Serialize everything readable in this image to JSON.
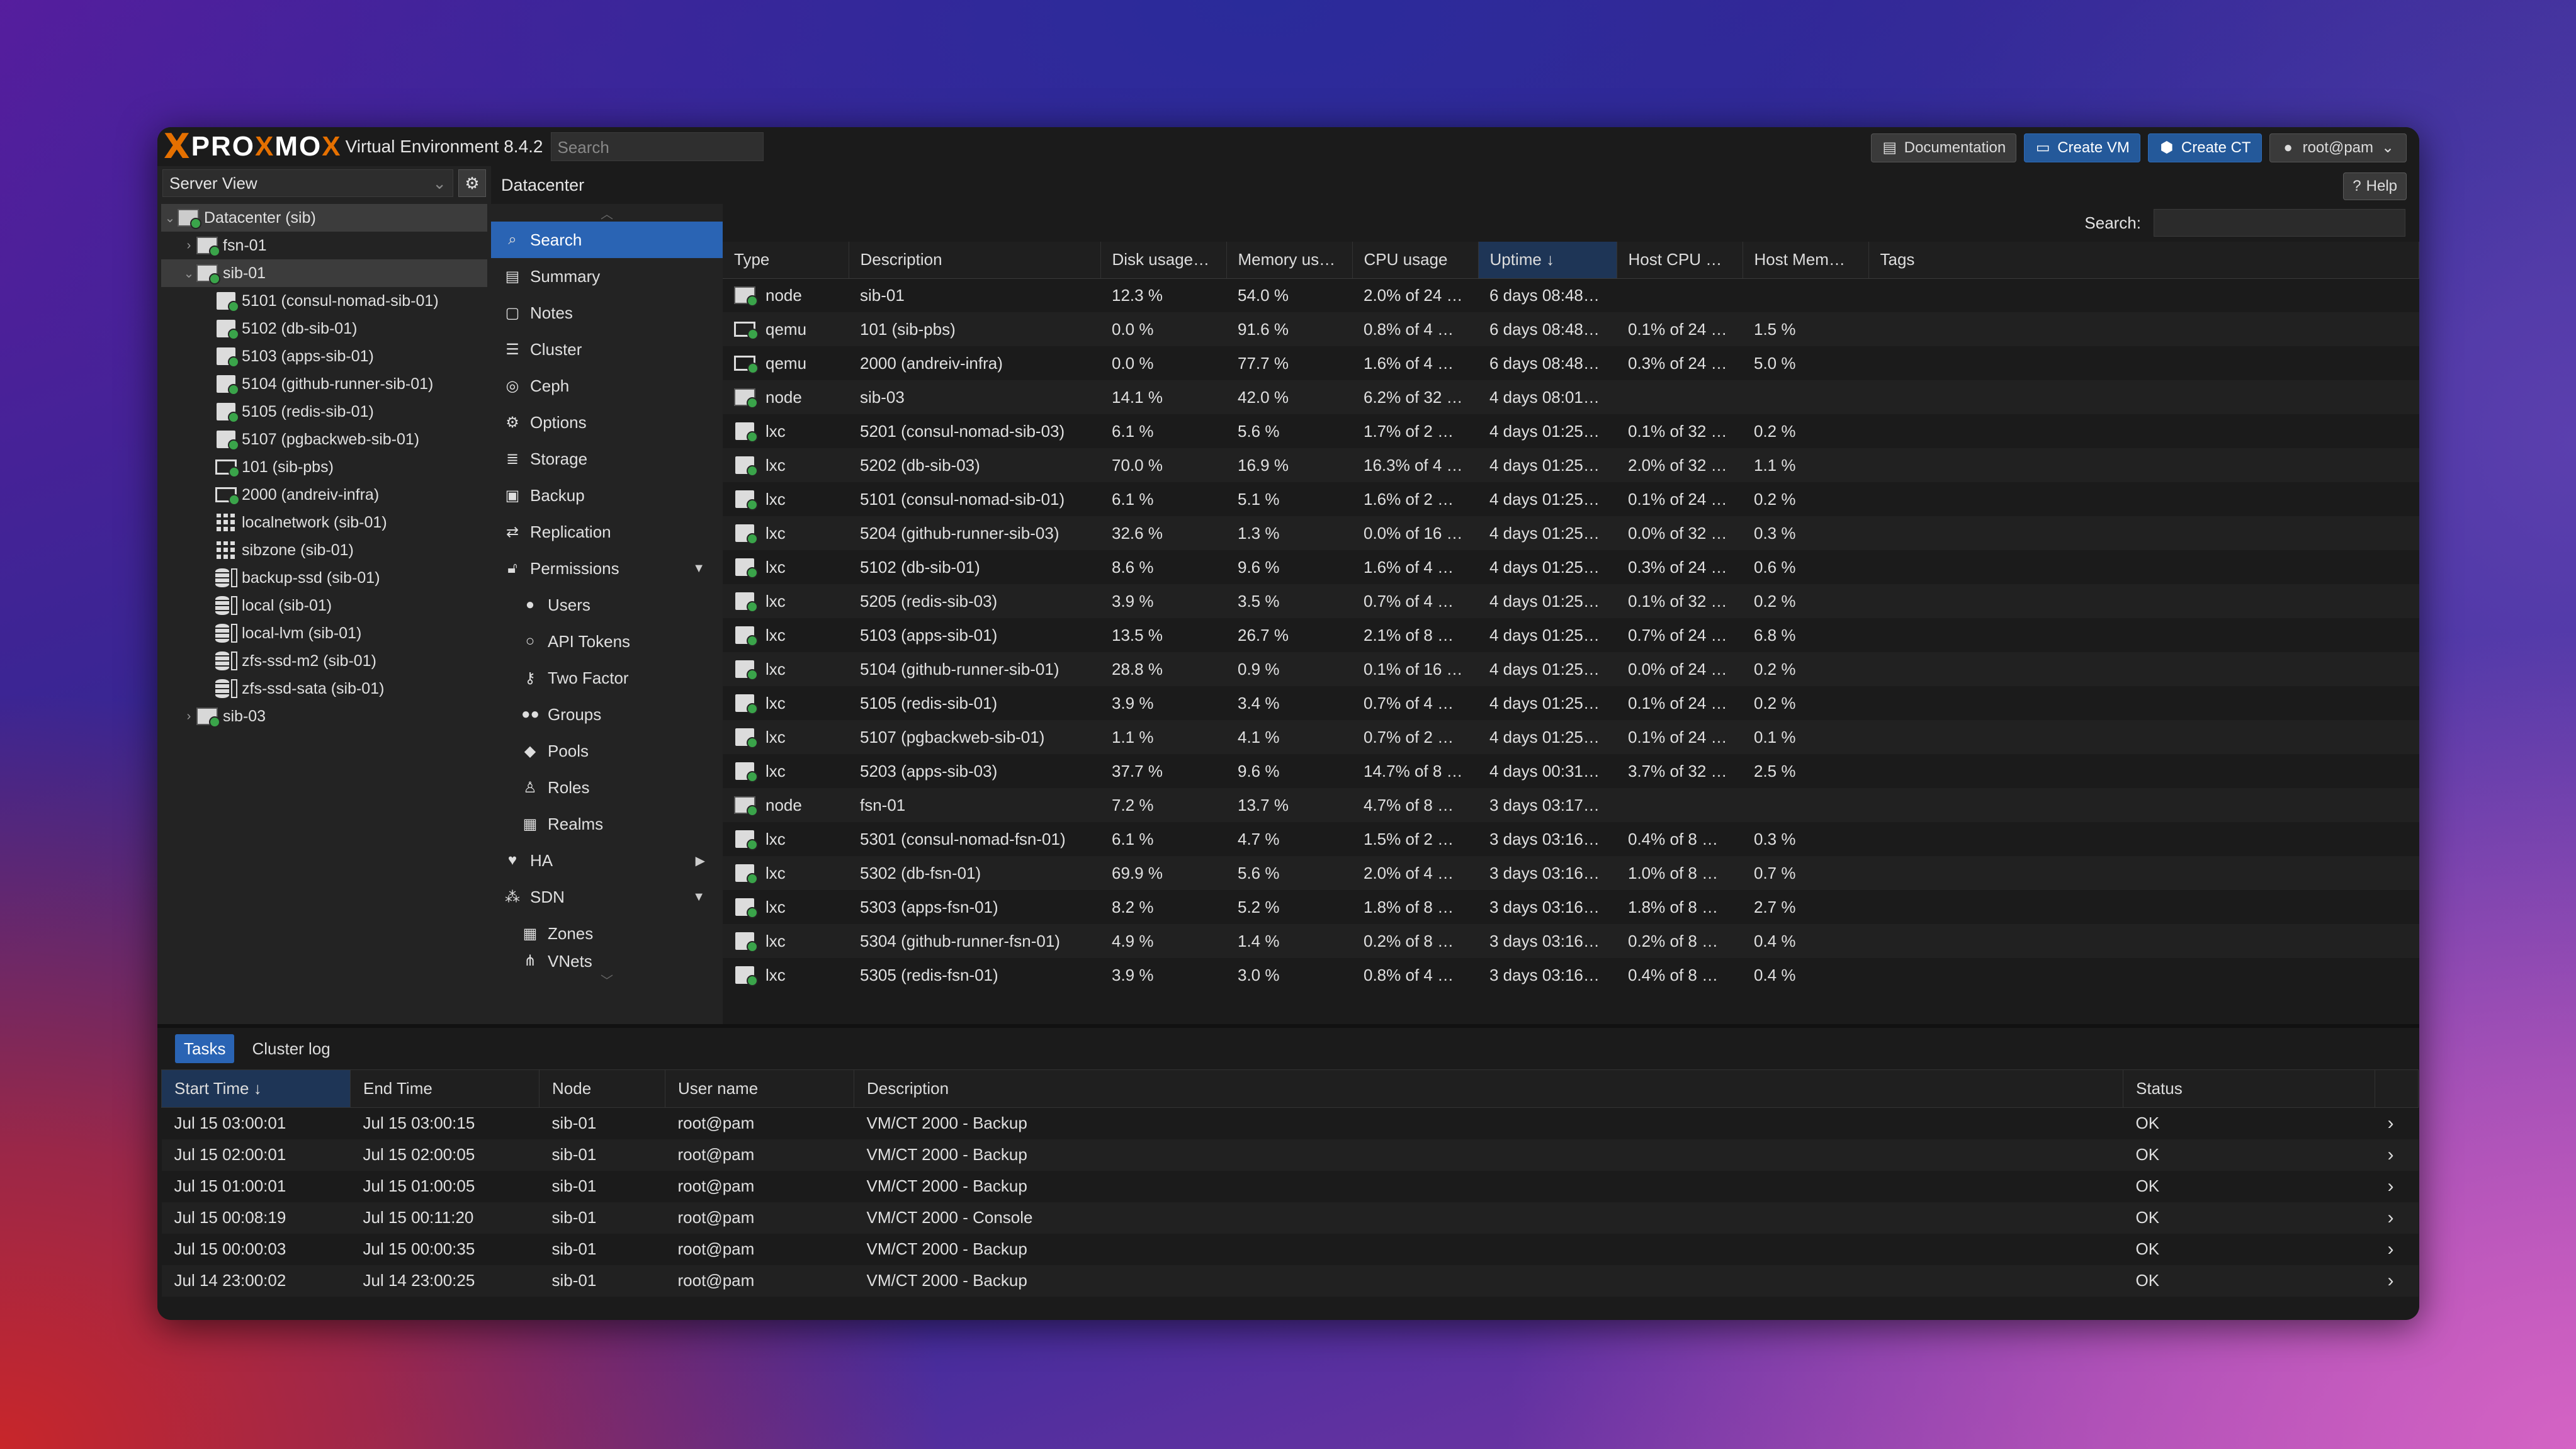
{
  "app": {
    "logo_text_pro": "PRO",
    "logo_x": "X",
    "logo_text_mox": "MO",
    "logo_text_x2": "X",
    "subtitle": "Virtual Environment 8.4.2",
    "search_placeholder": "Search"
  },
  "toolbar": {
    "documentation": "Documentation",
    "create_vm": "Create VM",
    "create_ct": "Create CT",
    "user": "root@pam"
  },
  "resource_tree": {
    "view": "Server View",
    "items": [
      {
        "label": "Datacenter (sib)",
        "icon": "datacenter-icon"
      },
      {
        "label": "fsn-01",
        "icon": "node-icon"
      },
      {
        "label": "sib-01",
        "icon": "node-icon"
      },
      {
        "label": "5101 (consul-nomad-sib-01)",
        "icon": "container-icon"
      },
      {
        "label": "5102 (db-sib-01)",
        "icon": "container-icon"
      },
      {
        "label": "5103 (apps-sib-01)",
        "icon": "container-icon"
      },
      {
        "label": "5104 (github-runner-sib-01)",
        "icon": "container-icon"
      },
      {
        "label": "5105 (redis-sib-01)",
        "icon": "container-icon"
      },
      {
        "label": "5107 (pgbackweb-sib-01)",
        "icon": "container-icon"
      },
      {
        "label": "101 (sib-pbs)",
        "icon": "vm-icon"
      },
      {
        "label": "2000 (andreiv-infra)",
        "icon": "vm-icon"
      },
      {
        "label": "localnetwork (sib-01)",
        "icon": "network-grid-icon"
      },
      {
        "label": "sibzone (sib-01)",
        "icon": "network-grid-icon"
      },
      {
        "label": "backup-ssd (sib-01)",
        "icon": "storage-icon"
      },
      {
        "label": "local (sib-01)",
        "icon": "storage-icon"
      },
      {
        "label": "local-lvm (sib-01)",
        "icon": "storage-icon"
      },
      {
        "label": "zfs-ssd-m2 (sib-01)",
        "icon": "storage-icon"
      },
      {
        "label": "zfs-ssd-sata (sib-01)",
        "icon": "storage-icon"
      },
      {
        "label": "sib-03",
        "icon": "node-icon"
      }
    ]
  },
  "breadcrumb": "Datacenter",
  "help": "Help",
  "menu": [
    {
      "label": "Search",
      "icon": "search-icon"
    },
    {
      "label": "Summary",
      "icon": "book-icon"
    },
    {
      "label": "Notes",
      "icon": "notes-icon"
    },
    {
      "label": "Cluster",
      "icon": "server-icon"
    },
    {
      "label": "Ceph",
      "icon": "ceph-icon"
    },
    {
      "label": "Options",
      "icon": "gear-icon"
    },
    {
      "label": "Storage",
      "icon": "database-icon"
    },
    {
      "label": "Backup",
      "icon": "floppy-icon"
    },
    {
      "label": "Replication",
      "icon": "retweet-icon"
    },
    {
      "label": "Permissions",
      "icon": "unlock-icon"
    },
    {
      "label": "Users",
      "icon": "user-icon"
    },
    {
      "label": "API Tokens",
      "icon": "user-outline-icon"
    },
    {
      "label": "Two Factor",
      "icon": "key-icon"
    },
    {
      "label": "Groups",
      "icon": "users-icon"
    },
    {
      "label": "Pools",
      "icon": "tags-icon"
    },
    {
      "label": "Roles",
      "icon": "male-icon"
    },
    {
      "label": "Realms",
      "icon": "address-book-icon"
    },
    {
      "label": "HA",
      "icon": "heartbeat-icon"
    },
    {
      "label": "SDN",
      "icon": "sdn-icon"
    },
    {
      "label": "Zones",
      "icon": "grid-icon"
    },
    {
      "label": "VNets",
      "icon": "network-icon"
    }
  ],
  "grid": {
    "search_label": "Search:",
    "columns": [
      "Type",
      "Description",
      "Disk usage…",
      "Memory us…",
      "CPU usage",
      "Uptime ↓",
      "Host CPU …",
      "Host Mem…",
      "Tags"
    ],
    "rows": [
      {
        "icon": "node-icon",
        "type": "node",
        "desc": "sib-01",
        "disk": "12.3 %",
        "mem": "54.0 %",
        "cpu": "2.0% of 24 …",
        "uptime": "6 days 08:48…",
        "hcpu": "",
        "hmem": ""
      },
      {
        "icon": "vm-icon",
        "type": "qemu",
        "desc": "101 (sib-pbs)",
        "disk": "0.0 %",
        "mem": "91.6 %",
        "cpu": "0.8% of 4 …",
        "uptime": "6 days 08:48…",
        "hcpu": "0.1% of 24 …",
        "hmem": "1.5 %"
      },
      {
        "icon": "vm-icon",
        "type": "qemu",
        "desc": "2000 (andreiv-infra)",
        "disk": "0.0 %",
        "mem": "77.7 %",
        "cpu": "1.6% of 4 …",
        "uptime": "6 days 08:48…",
        "hcpu": "0.3% of 24 …",
        "hmem": "5.0 %"
      },
      {
        "icon": "node-icon",
        "type": "node",
        "desc": "sib-03",
        "disk": "14.1 %",
        "mem": "42.0 %",
        "cpu": "6.2% of 32 …",
        "uptime": "4 days 08:01…",
        "hcpu": "",
        "hmem": ""
      },
      {
        "icon": "container-icon",
        "type": "lxc",
        "desc": "5201 (consul-nomad-sib-03)",
        "disk": "6.1 %",
        "mem": "5.6 %",
        "cpu": "1.7% of 2 …",
        "uptime": "4 days 01:25…",
        "hcpu": "0.1% of 32 …",
        "hmem": "0.2 %"
      },
      {
        "icon": "container-icon",
        "type": "lxc",
        "desc": "5202 (db-sib-03)",
        "disk": "70.0 %",
        "mem": "16.9 %",
        "cpu": "16.3% of 4 …",
        "uptime": "4 days 01:25…",
        "hcpu": "2.0% of 32 …",
        "hmem": "1.1 %"
      },
      {
        "icon": "container-icon",
        "type": "lxc",
        "desc": "5101 (consul-nomad-sib-01)",
        "disk": "6.1 %",
        "mem": "5.1 %",
        "cpu": "1.6% of 2 …",
        "uptime": "4 days 01:25…",
        "hcpu": "0.1% of 24 …",
        "hmem": "0.2 %"
      },
      {
        "icon": "container-icon",
        "type": "lxc",
        "desc": "5204 (github-runner-sib-03)",
        "disk": "32.6 %",
        "mem": "1.3 %",
        "cpu": "0.0% of 16 …",
        "uptime": "4 days 01:25…",
        "hcpu": "0.0% of 32 …",
        "hmem": "0.3 %"
      },
      {
        "icon": "container-icon",
        "type": "lxc",
        "desc": "5102 (db-sib-01)",
        "disk": "8.6 %",
        "mem": "9.6 %",
        "cpu": "1.6% of 4 …",
        "uptime": "4 days 01:25…",
        "hcpu": "0.3% of 24 …",
        "hmem": "0.6 %"
      },
      {
        "icon": "container-icon",
        "type": "lxc",
        "desc": "5205 (redis-sib-03)",
        "disk": "3.9 %",
        "mem": "3.5 %",
        "cpu": "0.7% of 4 …",
        "uptime": "4 days 01:25…",
        "hcpu": "0.1% of 32 …",
        "hmem": "0.2 %"
      },
      {
        "icon": "container-icon",
        "type": "lxc",
        "desc": "5103 (apps-sib-01)",
        "disk": "13.5 %",
        "mem": "26.7 %",
        "cpu": "2.1% of 8 …",
        "uptime": "4 days 01:25…",
        "hcpu": "0.7% of 24 …",
        "hmem": "6.8 %"
      },
      {
        "icon": "container-icon",
        "type": "lxc",
        "desc": "5104 (github-runner-sib-01)",
        "disk": "28.8 %",
        "mem": "0.9 %",
        "cpu": "0.1% of 16 …",
        "uptime": "4 days 01:25…",
        "hcpu": "0.0% of 24 …",
        "hmem": "0.2 %"
      },
      {
        "icon": "container-icon",
        "type": "lxc",
        "desc": "5105 (redis-sib-01)",
        "disk": "3.9 %",
        "mem": "3.4 %",
        "cpu": "0.7% of 4 …",
        "uptime": "4 days 01:25…",
        "hcpu": "0.1% of 24 …",
        "hmem": "0.2 %"
      },
      {
        "icon": "container-icon",
        "type": "lxc",
        "desc": "5107 (pgbackweb-sib-01)",
        "disk": "1.1 %",
        "mem": "4.1 %",
        "cpu": "0.7% of 2 …",
        "uptime": "4 days 01:25…",
        "hcpu": "0.1% of 24 …",
        "hmem": "0.1 %"
      },
      {
        "icon": "container-icon",
        "type": "lxc",
        "desc": "5203 (apps-sib-03)",
        "disk": "37.7 %",
        "mem": "9.6 %",
        "cpu": "14.7% of 8 …",
        "uptime": "4 days 00:31…",
        "hcpu": "3.7% of 32 …",
        "hmem": "2.5 %"
      },
      {
        "icon": "node-icon",
        "type": "node",
        "desc": "fsn-01",
        "disk": "7.2 %",
        "mem": "13.7 %",
        "cpu": "4.7% of 8 …",
        "uptime": "3 days 03:17…",
        "hcpu": "",
        "hmem": ""
      },
      {
        "icon": "container-icon",
        "type": "lxc",
        "desc": "5301 (consul-nomad-fsn-01)",
        "disk": "6.1 %",
        "mem": "4.7 %",
        "cpu": "1.5% of 2 …",
        "uptime": "3 days 03:16…",
        "hcpu": "0.4% of 8 …",
        "hmem": "0.3 %"
      },
      {
        "icon": "container-icon",
        "type": "lxc",
        "desc": "5302 (db-fsn-01)",
        "disk": "69.9 %",
        "mem": "5.6 %",
        "cpu": "2.0% of 4 …",
        "uptime": "3 days 03:16…",
        "hcpu": "1.0% of 8 …",
        "hmem": "0.7 %"
      },
      {
        "icon": "container-icon",
        "type": "lxc",
        "desc": "5303 (apps-fsn-01)",
        "disk": "8.2 %",
        "mem": "5.2 %",
        "cpu": "1.8% of 8 …",
        "uptime": "3 days 03:16…",
        "hcpu": "1.8% of 8 …",
        "hmem": "2.7 %"
      },
      {
        "icon": "container-icon",
        "type": "lxc",
        "desc": "5304 (github-runner-fsn-01)",
        "disk": "4.9 %",
        "mem": "1.4 %",
        "cpu": "0.2% of 8 …",
        "uptime": "3 days 03:16…",
        "hcpu": "0.2% of 8 …",
        "hmem": "0.4 %"
      },
      {
        "icon": "container-icon",
        "type": "lxc",
        "desc": "5305 (redis-fsn-01)",
        "disk": "3.9 %",
        "mem": "3.0 %",
        "cpu": "0.8% of 4 …",
        "uptime": "3 days 03:16…",
        "hcpu": "0.4% of 8 …",
        "hmem": "0.4 %"
      }
    ]
  },
  "tasks": {
    "tabs": [
      "Tasks",
      "Cluster log"
    ],
    "columns": [
      "Start Time ↓",
      "End Time",
      "Node",
      "User name",
      "Description",
      "Status"
    ],
    "rows": [
      {
        "start": "Jul 15 03:00:01",
        "end": "Jul 15 03:00:15",
        "node": "sib-01",
        "user": "root@pam",
        "desc": "VM/CT 2000 - Backup",
        "status": "OK"
      },
      {
        "start": "Jul 15 02:00:01",
        "end": "Jul 15 02:00:05",
        "node": "sib-01",
        "user": "root@pam",
        "desc": "VM/CT 2000 - Backup",
        "status": "OK"
      },
      {
        "start": "Jul 15 01:00:01",
        "end": "Jul 15 01:00:05",
        "node": "sib-01",
        "user": "root@pam",
        "desc": "VM/CT 2000 - Backup",
        "status": "OK"
      },
      {
        "start": "Jul 15 00:08:19",
        "end": "Jul 15 00:11:20",
        "node": "sib-01",
        "user": "root@pam",
        "desc": "VM/CT 2000 - Console",
        "status": "OK"
      },
      {
        "start": "Jul 15 00:00:03",
        "end": "Jul 15 00:00:35",
        "node": "sib-01",
        "user": "root@pam",
        "desc": "VM/CT 2000 - Backup",
        "status": "OK"
      },
      {
        "start": "Jul 14 23:00:02",
        "end": "Jul 14 23:00:25",
        "node": "sib-01",
        "user": "root@pam",
        "desc": "VM/CT 2000 - Backup",
        "status": "OK"
      }
    ]
  },
  "colors": {
    "accent": "#2a64b4",
    "brand_orange": "#e57000",
    "status_green": "#3aa44a"
  }
}
